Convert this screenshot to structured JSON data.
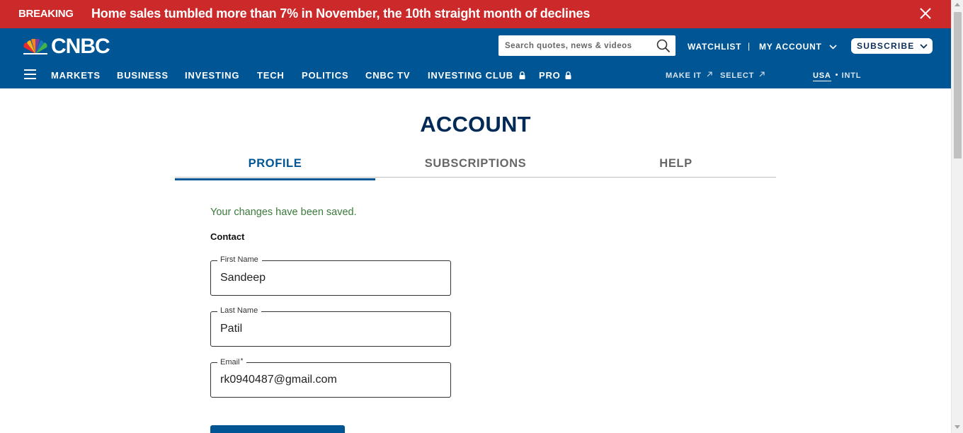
{
  "breaking": {
    "label": "BREAKING",
    "text": "Home sales tumbled more than 7% in November, the 10th straight month of declines"
  },
  "header": {
    "logo_text": "CNBC",
    "search_placeholder": "Search quotes, news & videos",
    "watchlist": "WATCHLIST",
    "separator": "|",
    "my_account": "MY ACCOUNT",
    "subscribe": "SUBSCRIBE"
  },
  "nav": {
    "items": [
      "MARKETS",
      "BUSINESS",
      "INVESTING",
      "TECH",
      "POLITICS",
      "CNBC TV",
      "INVESTING CLUB",
      "PRO"
    ],
    "make_it": "MAKE IT",
    "select": "SELECT",
    "usa": "USA",
    "intl": "INTL"
  },
  "main": {
    "title": "ACCOUNT",
    "tabs": [
      {
        "label": "PROFILE",
        "active": true
      },
      {
        "label": "SUBSCRIPTIONS",
        "active": false
      },
      {
        "label": "HELP",
        "active": false
      }
    ],
    "saved_message": "Your changes have been saved.",
    "section_label": "Contact",
    "fields": {
      "first_name": {
        "label": "First Name",
        "value": "Sandeep"
      },
      "last_name": {
        "label": "Last Name",
        "value": "Patil"
      },
      "email": {
        "label": "Email",
        "required_mark": "*",
        "value": "rk0940487@gmail.com"
      }
    }
  },
  "colors": {
    "breaking_red": "#cc2a2a",
    "brand_blue": "#005594",
    "title_navy": "#002a55",
    "success_green": "#3a7a3a"
  },
  "icons": [
    "close-icon",
    "peacock-logo-icon",
    "search-icon",
    "chevron-down-icon",
    "hamburger-icon",
    "lock-icon",
    "external-link-icon"
  ]
}
